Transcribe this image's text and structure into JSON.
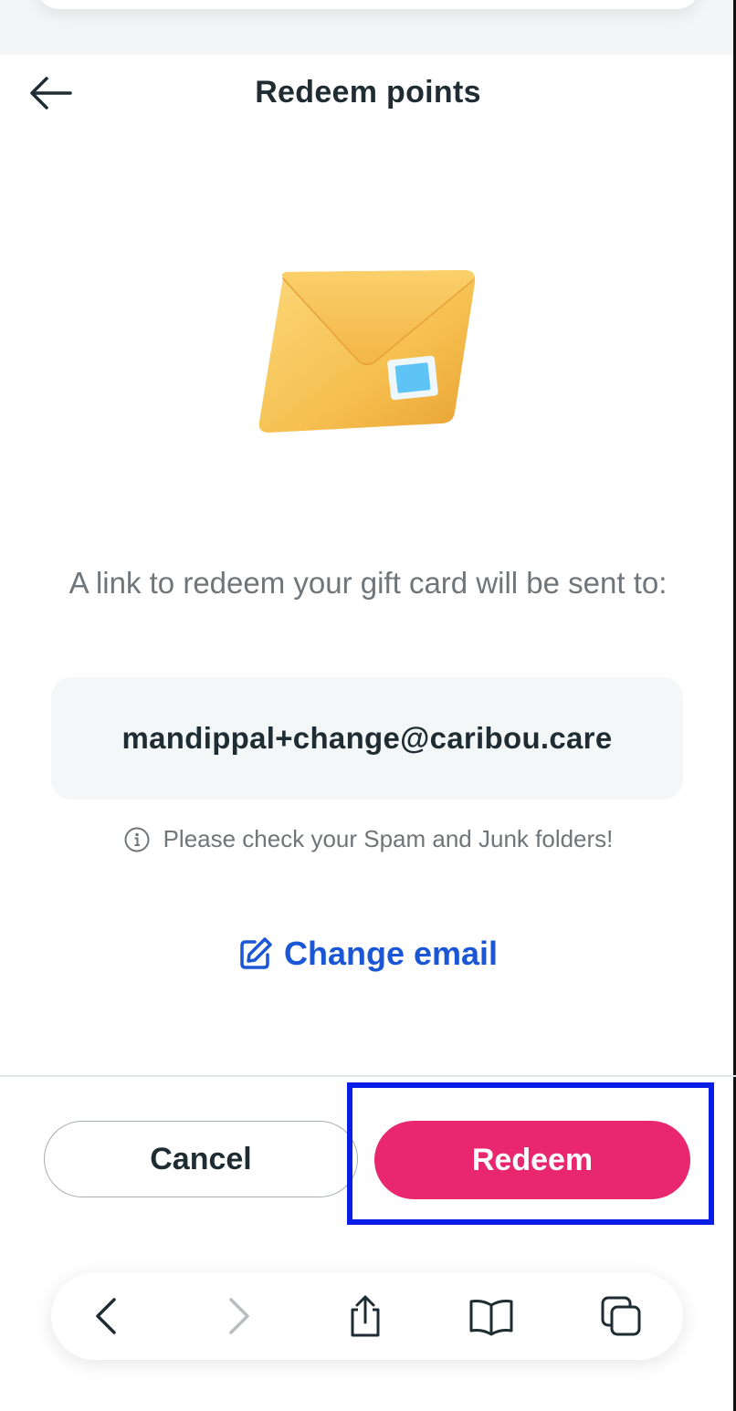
{
  "header": {
    "title": "Redeem points",
    "back_icon": "arrow-left-icon"
  },
  "illustration": {
    "name": "envelope-illustration",
    "colors": {
      "envelope": "#f5bf4f",
      "stamp": "#5ec3f5"
    }
  },
  "message": {
    "text": "A link to redeem your gift card will be sent to:"
  },
  "email": {
    "value": "mandippal+change@caribou.care"
  },
  "hint": {
    "icon": "info-icon",
    "text": "Please check your Spam and Junk folders!"
  },
  "change_email": {
    "icon": "edit-icon",
    "label": "Change email"
  },
  "actions": {
    "cancel_label": "Cancel",
    "redeem_label": "Redeem"
  },
  "browser_toolbar": {
    "items": [
      "back-chevron-icon",
      "forward-chevron-icon",
      "share-icon",
      "bookmarks-icon",
      "tabs-icon"
    ]
  },
  "colors": {
    "primary": "#e8276f",
    "link": "#1a56d6",
    "text_dark": "#1f2d33",
    "text_muted": "#707579",
    "highlight": "#0a1de6"
  }
}
